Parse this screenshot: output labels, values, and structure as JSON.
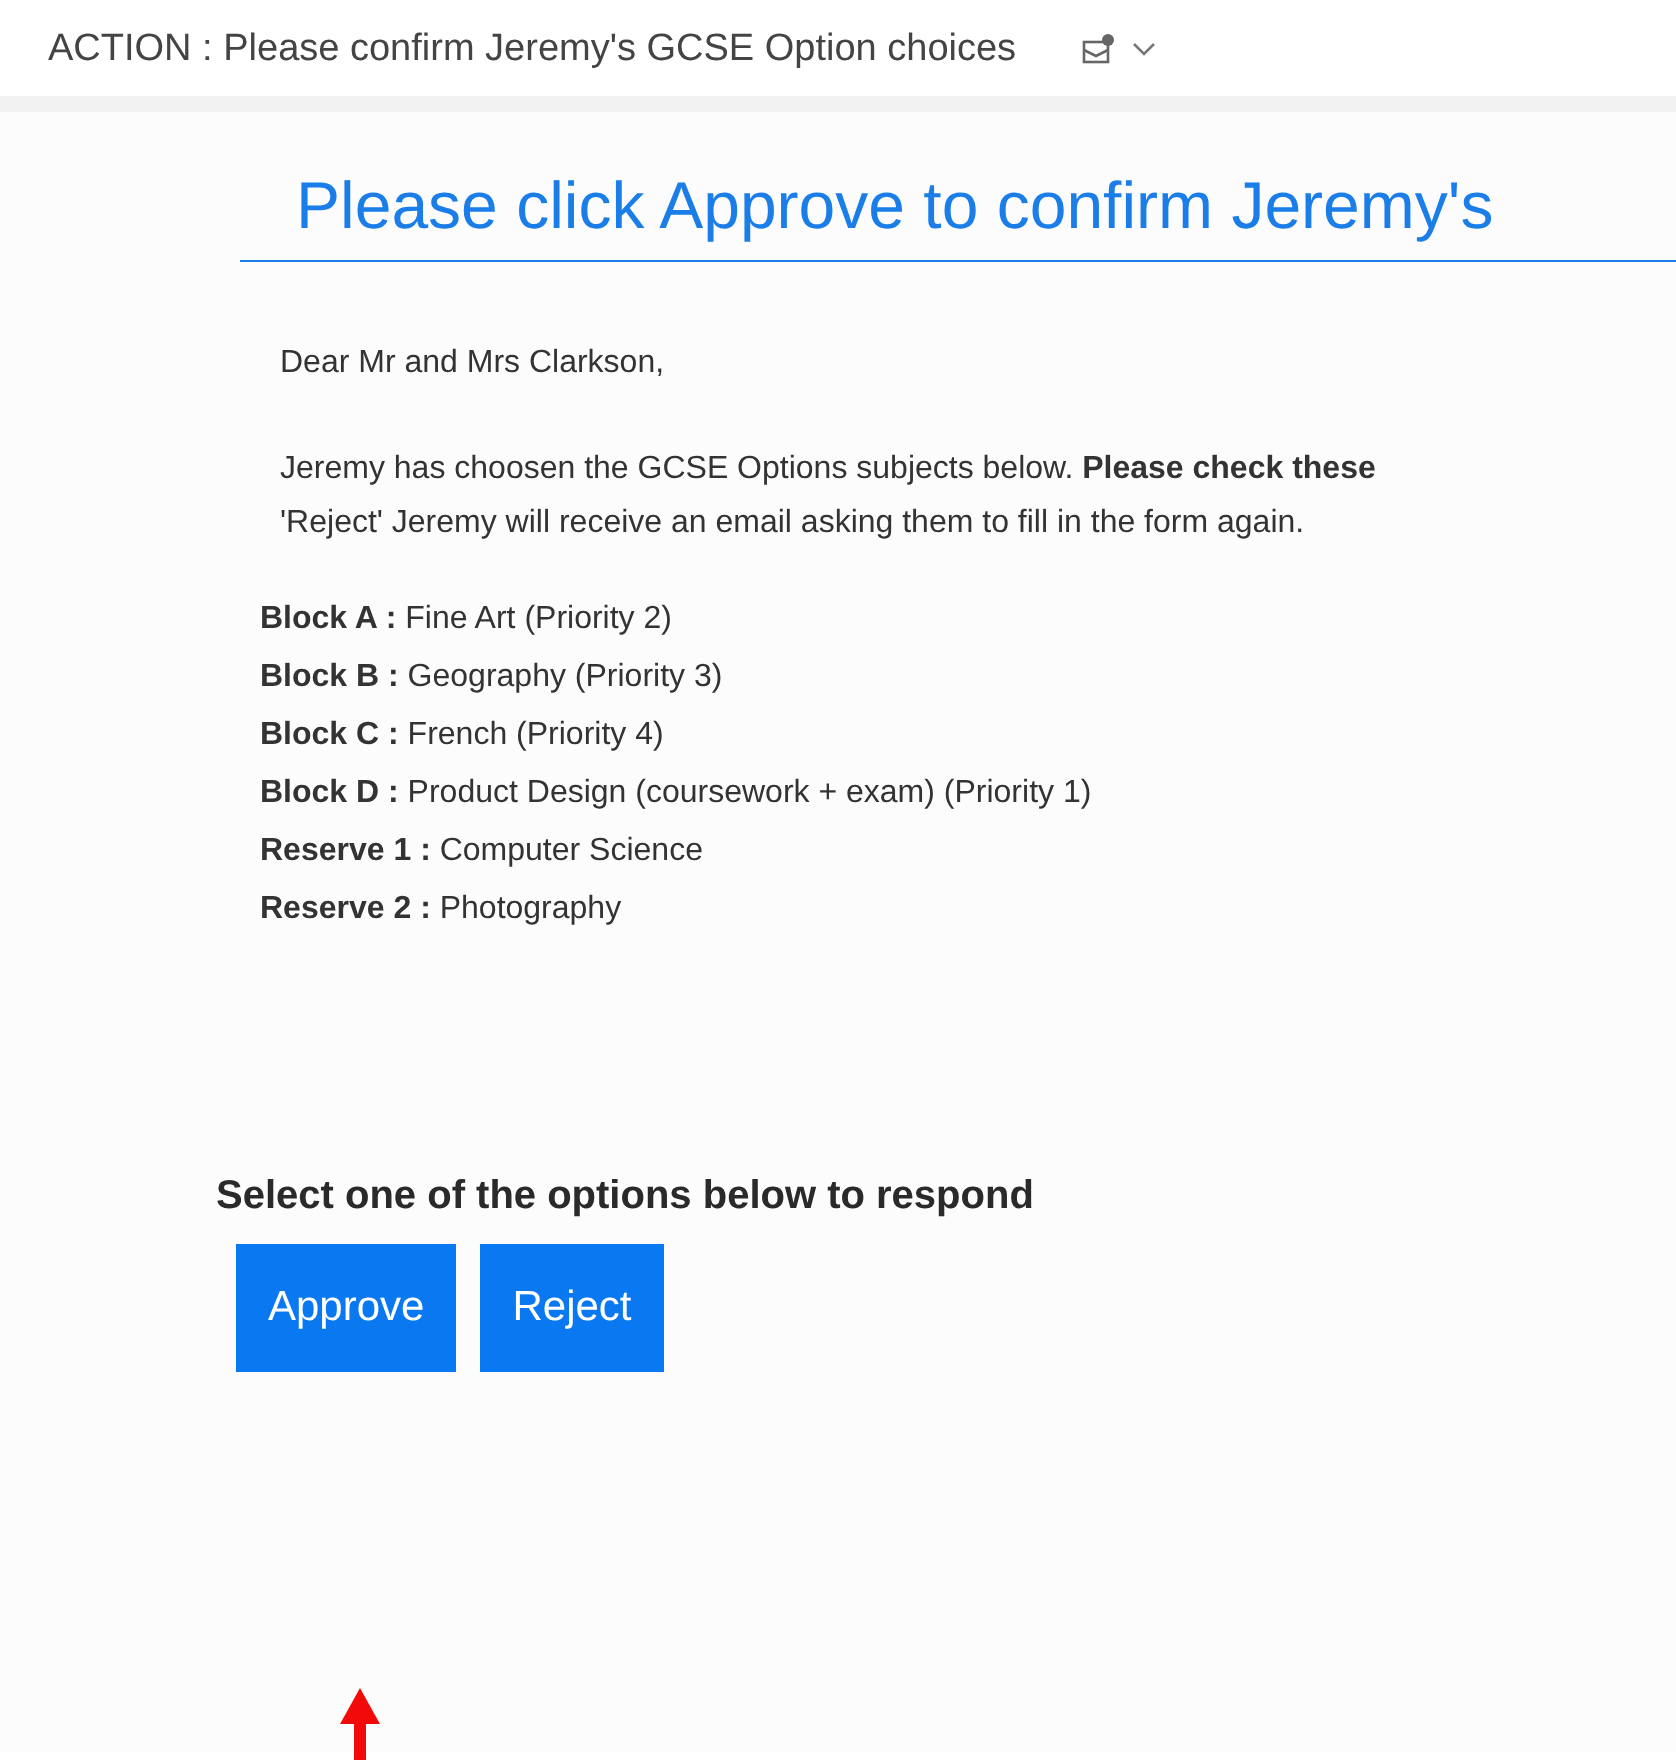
{
  "subject": "ACTION : Please confirm Jeremy's GCSE Option choices",
  "heading": "Please click Approve to confirm Jeremy's",
  "greeting": "Dear Mr and Mrs Clarkson,",
  "paragraph_lines": [
    "Jeremy has choosen the GCSE Options subjects below.  **Please check these**",
    "'Reject' Jeremy will receive an email asking them to fill in the form again."
  ],
  "choices": [
    {
      "label": "Block A :",
      "value": "Fine Art (Priority 2)"
    },
    {
      "label": "Block B :",
      "value": "Geography (Priority  3)"
    },
    {
      "label": "Block C :",
      "value": "French (Priority  4)"
    },
    {
      "label": "Block D :",
      "value": "Product Design (coursework + exam) (Priority  1)"
    },
    {
      "label": "Reserve 1 :",
      "value": "Computer Science"
    },
    {
      "label": "Reserve 2 :",
      "value": "Photography"
    }
  ],
  "respond_prompt": "Select one of the options below to respond",
  "buttons": [
    "Approve",
    "Reject"
  ]
}
